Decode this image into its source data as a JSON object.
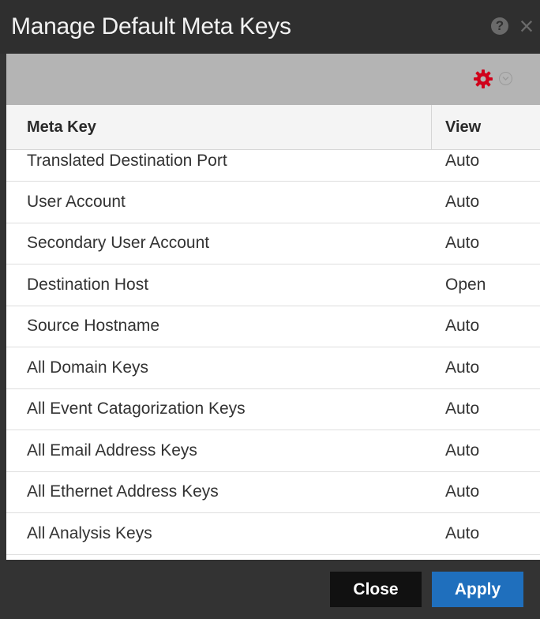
{
  "window": {
    "title": "Manage Default Meta Keys",
    "help_icon_glyph": "?",
    "close_icon_glyph": "×"
  },
  "toolbar": {
    "icons": [
      "gear-icon",
      "chevron-down-icon"
    ],
    "gear_color": "#d0021b"
  },
  "table": {
    "headers": {
      "meta_key": "Meta Key",
      "view": "View"
    },
    "rows": [
      {
        "meta_key": "Translated Destination Port",
        "view": "Auto"
      },
      {
        "meta_key": "User Account",
        "view": "Auto"
      },
      {
        "meta_key": "Secondary User Account",
        "view": "Auto"
      },
      {
        "meta_key": "Destination Host",
        "view": "Open"
      },
      {
        "meta_key": "Source Hostname",
        "view": "Auto"
      },
      {
        "meta_key": "All Domain Keys",
        "view": "Auto"
      },
      {
        "meta_key": "All Event Catagorization Keys",
        "view": "Auto"
      },
      {
        "meta_key": "All Email Address Keys",
        "view": "Auto"
      },
      {
        "meta_key": "All Ethernet Address Keys",
        "view": "Auto"
      },
      {
        "meta_key": "All Analysis Keys",
        "view": "Auto"
      }
    ]
  },
  "footer": {
    "close_label": "Close",
    "apply_label": "Apply",
    "apply_color": "#1f6fbd"
  }
}
